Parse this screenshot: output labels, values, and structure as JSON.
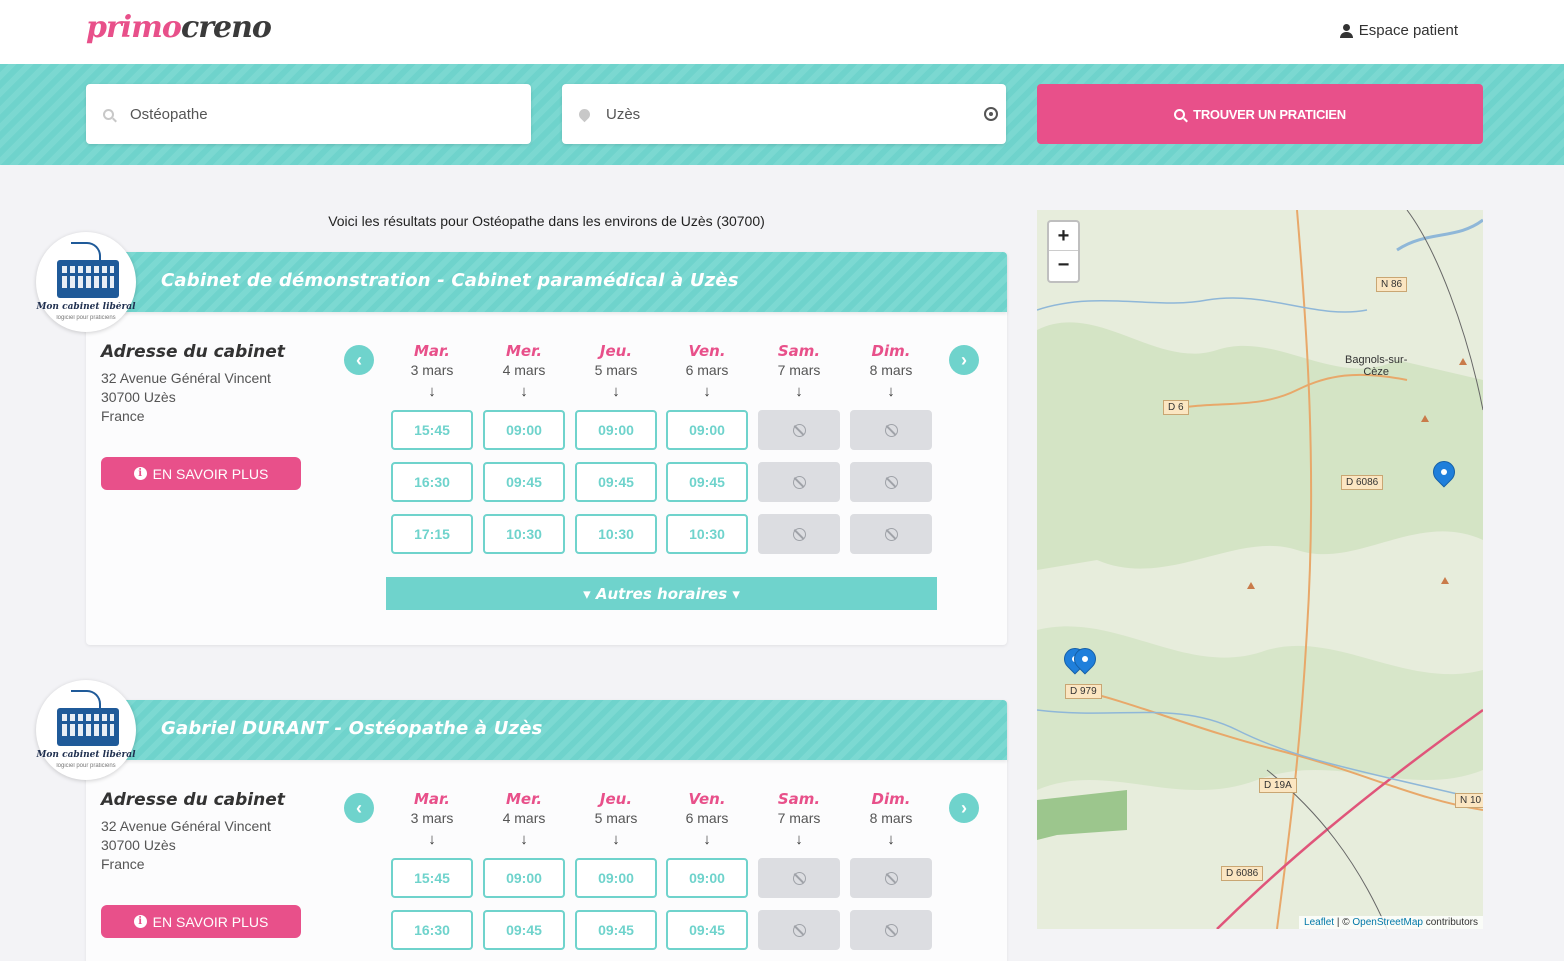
{
  "header": {
    "logo_primo": "primo",
    "logo_creno": "creno",
    "patient_space": "Espace patient"
  },
  "search": {
    "specialty_value": "Ostéopathe",
    "city_value": "Uzès",
    "find_button": "TROUVER UN PRATICIEN"
  },
  "results_text": "Voici les résultats pour Ostéopathe dans les environs de Uzès (30700)",
  "cards": [
    {
      "title": "Cabinet de démonstration - Cabinet paramédical à Uzès",
      "avatar_text": "Mon cabinet libéral",
      "avatar_sub": "logiciel pour praticiens",
      "address_title": "Adresse du cabinet",
      "address_lines": [
        "32 Avenue Général Vincent",
        "30700 Uzès",
        "France"
      ],
      "info_button": "EN SAVOIR PLUS",
      "more_button": "▾ Autres horaires ▾",
      "days": [
        {
          "name": "Mar.",
          "date": "3 mars",
          "slots": [
            "15:45",
            "16:30",
            "17:15"
          ]
        },
        {
          "name": "Mer.",
          "date": "4 mars",
          "slots": [
            "09:00",
            "09:45",
            "10:30"
          ]
        },
        {
          "name": "Jeu.",
          "date": "5 mars",
          "slots": [
            "09:00",
            "09:45",
            "10:30"
          ]
        },
        {
          "name": "Ven.",
          "date": "6 mars",
          "slots": [
            "09:00",
            "09:45",
            "10:30"
          ]
        },
        {
          "name": "Sam.",
          "date": "7 mars",
          "slots": [
            null,
            null,
            null
          ]
        },
        {
          "name": "Dim.",
          "date": "8 mars",
          "slots": [
            null,
            null,
            null
          ]
        }
      ]
    },
    {
      "title": "Gabriel DURANT - Ostéopathe à Uzès",
      "avatar_text": "Mon cabinet libéral",
      "avatar_sub": "logiciel pour praticiens",
      "address_title": "Adresse du cabinet",
      "address_lines": [
        "32 Avenue Général Vincent",
        "30700 Uzès",
        "France"
      ],
      "info_button": "EN SAVOIR PLUS",
      "days": [
        {
          "name": "Mar.",
          "date": "3 mars",
          "slots": [
            "15:45",
            "16:30"
          ]
        },
        {
          "name": "Mer.",
          "date": "4 mars",
          "slots": [
            "09:00",
            "09:45"
          ]
        },
        {
          "name": "Jeu.",
          "date": "5 mars",
          "slots": [
            "09:00",
            "09:45"
          ]
        },
        {
          "name": "Ven.",
          "date": "6 mars",
          "slots": [
            "09:00",
            "09:45"
          ]
        },
        {
          "name": "Sam.",
          "date": "7 mars",
          "slots": [
            null,
            null
          ]
        },
        {
          "name": "Dim.",
          "date": "8 mars",
          "slots": [
            null,
            null
          ]
        }
      ]
    }
  ],
  "map": {
    "zoom_in": "+",
    "zoom_out": "−",
    "towns": [
      "Bagnols-sur-",
      "Cèze"
    ],
    "roads": [
      "N 86",
      "D 6",
      "D 6086",
      "D 979",
      "D 19A",
      "N 10",
      "D 6086"
    ],
    "attribution_leaflet": "Leaflet",
    "attribution_sep": " | © ",
    "attribution_osm": "OpenStreetMap",
    "attribution_tail": " contributors"
  },
  "colors": {
    "accent_pink": "#e8508a",
    "accent_teal": "#6fd3cc",
    "disabled_slot": "#dcdde1",
    "marker_blue": "#1f7fdb"
  },
  "icons": [
    "search-icon",
    "location-pin-icon",
    "locate-icon",
    "user-icon",
    "info-icon",
    "chevron-left-icon",
    "chevron-right-icon",
    "ban-icon",
    "map-marker-icon"
  ]
}
